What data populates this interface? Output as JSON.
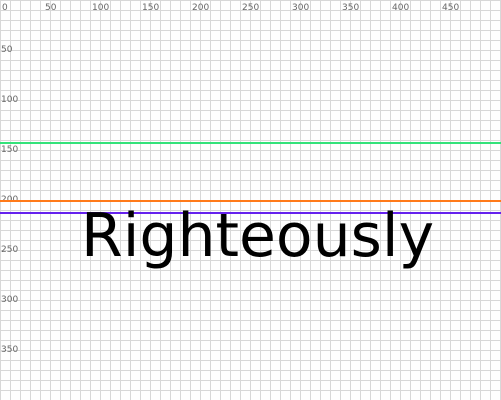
{
  "ruler": {
    "x_tick_labels": [
      "0",
      "50",
      "100",
      "150",
      "200",
      "250",
      "300",
      "350",
      "400",
      "450"
    ],
    "y_tick_labels": [
      "50",
      "100",
      "150",
      "200",
      "250",
      "300",
      "350"
    ]
  },
  "guides": {
    "line_1": {
      "value": 143,
      "color": "#33e27a"
    },
    "line_2": {
      "value": 201,
      "color": "#ff7a1a"
    },
    "line_3": {
      "value": 213,
      "color": "#6622ee"
    }
  },
  "sample": {
    "text": "Righteously"
  },
  "colors": {
    "grid": "#d8d8d8",
    "label": "#666666",
    "text": "#000000"
  }
}
